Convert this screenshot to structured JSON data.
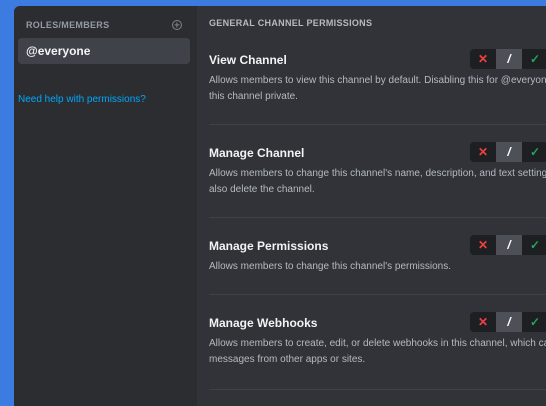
{
  "sidebar": {
    "title": "ROLES/MEMBERS",
    "roles": [
      {
        "label": "@everyone"
      }
    ],
    "help_link": "Need help with permissions?"
  },
  "main": {
    "section_title": "GENERAL CHANNEL PERMISSIONS",
    "permissions": [
      {
        "name": "View Channel",
        "description": "Allows members to view this channel by default. Disabling this for @everyone will make this channel private.",
        "state": "neutral"
      },
      {
        "name": "Manage Channel",
        "description": "Allows members to change this channel's name, description, and text settings. They can also delete the channel.",
        "state": "neutral"
      },
      {
        "name": "Manage Permissions",
        "description": "Allows members to change this channel's permissions.",
        "state": "neutral"
      },
      {
        "name": "Manage Webhooks",
        "description": "Allows members to create, edit, or delete webhooks in this channel, which can post messages from other apps or sites.",
        "state": "neutral"
      }
    ],
    "toggle_symbols": {
      "deny": "✕",
      "neutral": "/",
      "allow": "✓"
    }
  },
  "colors": {
    "deny": "#f23f43",
    "allow": "#23a55a",
    "link": "#00a8fc",
    "background_outer": "#3c7be0"
  }
}
